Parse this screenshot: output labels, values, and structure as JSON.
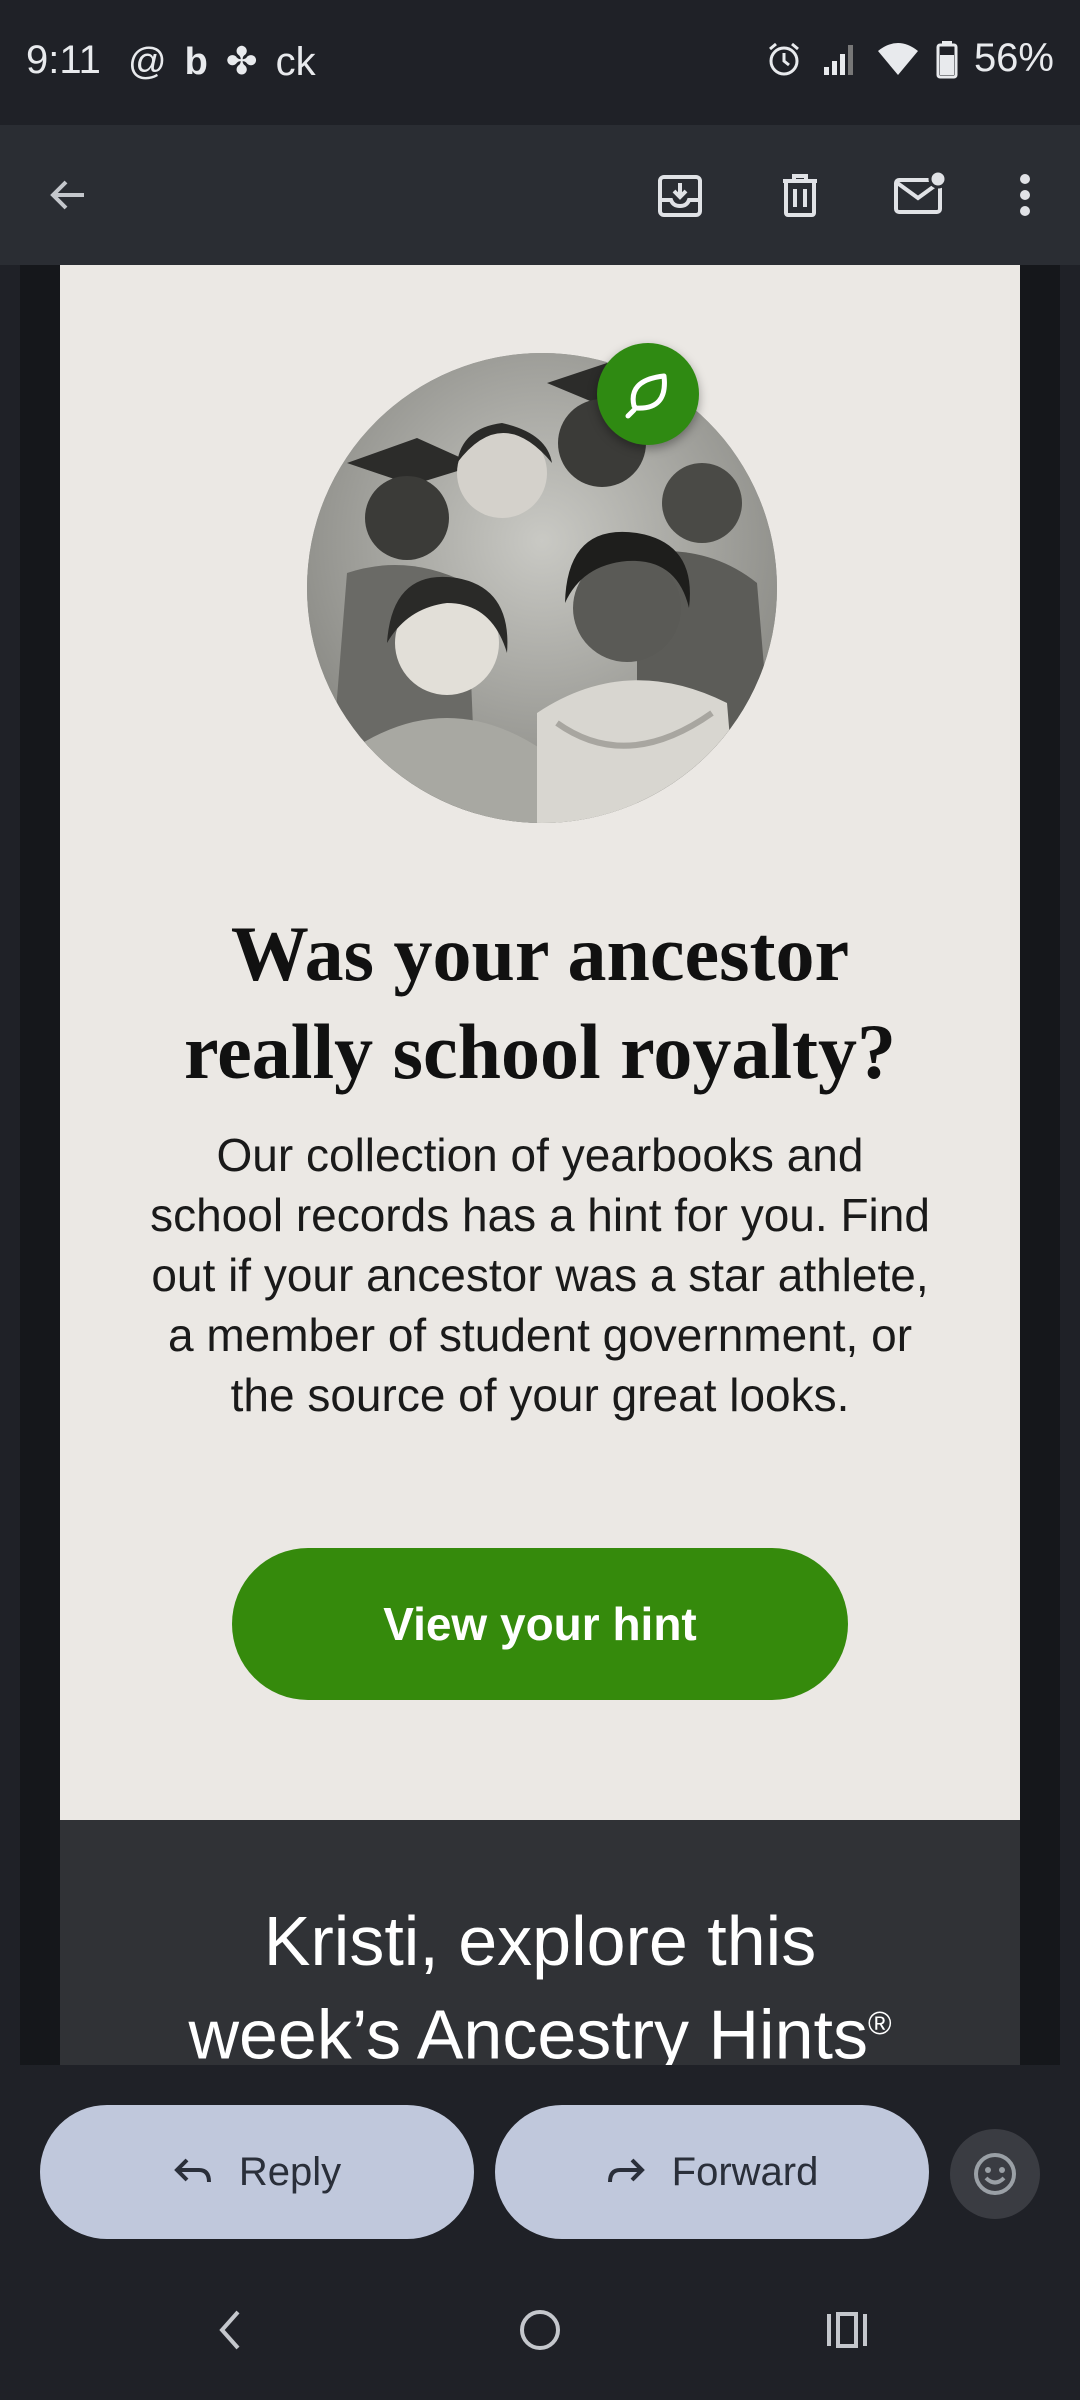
{
  "status_bar": {
    "time": "9:11",
    "app_icons": [
      "threads-icon",
      "bing-icon",
      "pinwheel-icon"
    ],
    "app_text": "ck",
    "battery": "56%"
  },
  "toolbar": {
    "icons": [
      "back-arrow-icon",
      "archive-icon",
      "delete-icon",
      "mark-unread-icon",
      "more-vert-icon"
    ]
  },
  "email": {
    "badge_icon": "leaf-chat-icon",
    "headline_line1": "Was your ancestor",
    "headline_line2": "really school royalty?",
    "body": "Our collection of yearbooks and school records has a hint for you. Find out if your ancestor was a star athlete, a member of student government, or the source of your great looks.",
    "cta_label": "View your hint",
    "section_heading_line1": "Kristi, explore this",
    "section_heading_line2": "week’s Ancestry Hints",
    "section_heading_mark": "®"
  },
  "actions": {
    "reply_label": "Reply",
    "forward_label": "Forward"
  },
  "colors": {
    "accent_green": "#358a0c",
    "card_bg": "#ebe8e4",
    "pill_bg": "#c0c8dc"
  }
}
